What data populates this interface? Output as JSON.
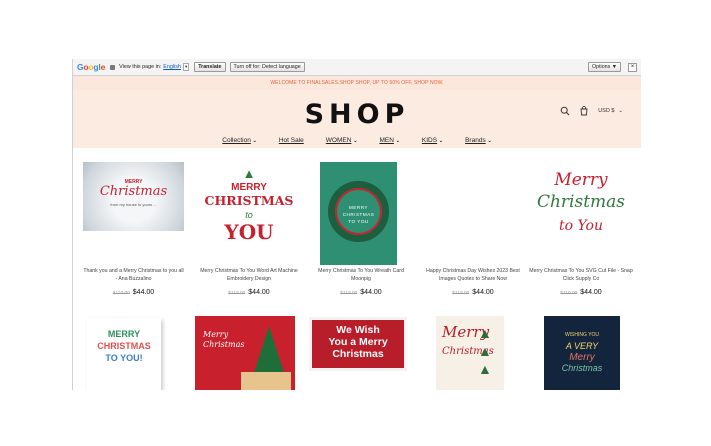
{
  "translate_bar": {
    "google": "Google",
    "view_text": "View this page in:",
    "language": "English",
    "translate_label": "Translate",
    "turn_off_label": "Turn off for: Detect language",
    "options_label": "Options ▼",
    "close_label": "×"
  },
  "promo": {
    "text": "WELCOME TO FINALSALES.SHOP SHOP, UP TO 50% OFF, SHOP NOW."
  },
  "header": {
    "logo": "SHOP",
    "currency": "USD $"
  },
  "nav": [
    {
      "label": "Collection"
    },
    {
      "label": "Hot Sale"
    },
    {
      "label": "WOMEN"
    },
    {
      "label": "MEN"
    },
    {
      "label": "KIDS"
    },
    {
      "label": "Brands"
    }
  ],
  "products_row1": [
    {
      "title": "Thank you and a Merry Christmas to you all - Ana Buzzalino",
      "old_price": "$110.00",
      "price": "$44.00",
      "image_text": [
        "MERRY",
        "Christmas",
        "from my house to yours ..."
      ]
    },
    {
      "title": "Merry Christmas To You Word Art Machine Embroidery Design",
      "old_price": "$110.00",
      "price": "$44.00",
      "image_text": [
        "MERRY",
        "CHRISTMAS",
        "to",
        "YOU"
      ]
    },
    {
      "title": "Merry Christmas To You Wreath Card Moonpig",
      "old_price": "$110.00",
      "price": "$44.00",
      "image_text": [
        "MERRY",
        "CHRISTMAS",
        "TO YOU"
      ]
    },
    {
      "title": "Happy Christmas Day Wishes 2023 Best Images Quotes to Share Now",
      "old_price": "$110.00",
      "price": "$44.00",
      "image_text": []
    },
    {
      "title": "Merry Christmas To You SVG Cut File - Snap Click Supply Co",
      "old_price": "$110.00",
      "price": "$44.00",
      "image_text": [
        "Merry",
        "Christmas",
        "to You"
      ]
    }
  ],
  "products_row2": [
    {
      "image_text": [
        "MERRY",
        "CHRISTMAS",
        "TO YOU!"
      ]
    },
    {
      "image_text": [
        "Merry",
        "Christmas"
      ]
    },
    {
      "image_text": [
        "We Wish",
        "You a Merry",
        "Christmas"
      ]
    },
    {
      "image_text": [
        "Merry",
        "Christmas"
      ]
    },
    {
      "image_text": [
        "WISHING YOU",
        "A VERY",
        "Merry",
        "Christmas"
      ]
    }
  ],
  "colors": {
    "promo_bg": "#fbe7dc",
    "promo_text": "#e5603e",
    "header_bg": "#fcebe1"
  }
}
